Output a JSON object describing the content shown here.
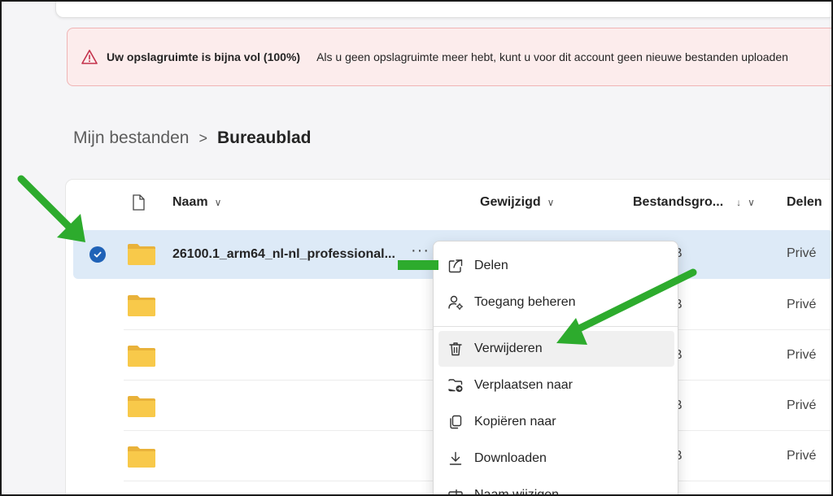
{
  "alert": {
    "title": "Uw opslagruimte is bijna vol (100%)",
    "message": "Als u geen opslagruimte meer hebt, kunt u voor dit account geen nieuwe bestanden uploaden",
    "icon": "warning-icon",
    "color": "#c4314b"
  },
  "breadcrumb": {
    "parent": "Mijn bestanden",
    "separator": ">",
    "current": "Bureaublad"
  },
  "columns": {
    "name": "Naam",
    "modified": "Gewijzigd",
    "size": "Bestandsgro...",
    "sharing": "Delen"
  },
  "rows": [
    {
      "name": "26100.1_arm64_nl-nl_professional...",
      "size": "B",
      "sharing": "Privé",
      "selected": true
    },
    {
      "name": "",
      "size": "B",
      "sharing": "Privé"
    },
    {
      "name": "",
      "size": "B",
      "sharing": "Privé"
    },
    {
      "name": "",
      "size": "B",
      "sharing": "Privé"
    },
    {
      "name": "",
      "size": "B",
      "sharing": "Privé"
    }
  ],
  "more_label": "···",
  "context_menu": {
    "items": [
      {
        "label": "Delen",
        "icon": "share-icon"
      },
      {
        "label": "Toegang beheren",
        "icon": "manage-access-icon"
      },
      {
        "label": "Verwijderen",
        "icon": "trash-icon"
      },
      {
        "label": "Verplaatsen naar",
        "icon": "move-icon"
      },
      {
        "label": "Kopiëren naar",
        "icon": "copy-icon"
      },
      {
        "label": "Downloaden",
        "icon": "download-icon"
      },
      {
        "label": "Naam wijzigen",
        "icon": "rename-icon"
      }
    ]
  },
  "colors": {
    "accent": "#1f62b7",
    "selected_row": "#ddeaf7",
    "folder": "#f8c94a",
    "annotation_arrow": "#2dab2d"
  }
}
